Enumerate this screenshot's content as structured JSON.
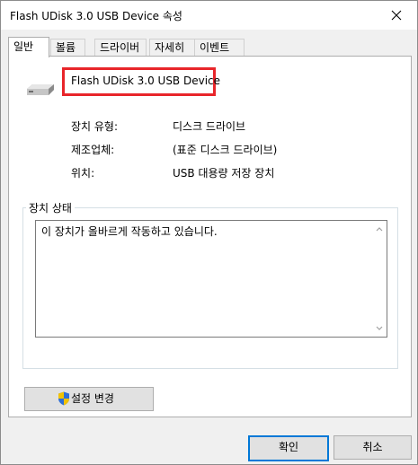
{
  "window": {
    "title": "Flash UDisk 3.0 USB Device 속성"
  },
  "tabs": [
    {
      "label": "일반"
    },
    {
      "label": "볼륨"
    },
    {
      "label": "드라이버"
    },
    {
      "label": "자세히"
    },
    {
      "label": "이벤트"
    }
  ],
  "device": {
    "name": "Flash UDisk 3.0 USB Device",
    "icon": "drive-icon"
  },
  "properties": [
    {
      "label": "장치 유형:",
      "value": "디스크 드라이브"
    },
    {
      "label": "제조업체:",
      "value": "(표준 디스크 드라이브)"
    },
    {
      "label": "위치:",
      "value": "USB 대용량 저장 장치"
    }
  ],
  "status": {
    "group_label": "장치 상태",
    "text": "이 장치가 올바르게 작동하고 있습니다."
  },
  "buttons": {
    "change_settings": "설정 변경",
    "ok": "확인",
    "cancel": "취소"
  },
  "colors": {
    "highlight_border": "#e8252a",
    "focus_blue": "#0078d7"
  }
}
